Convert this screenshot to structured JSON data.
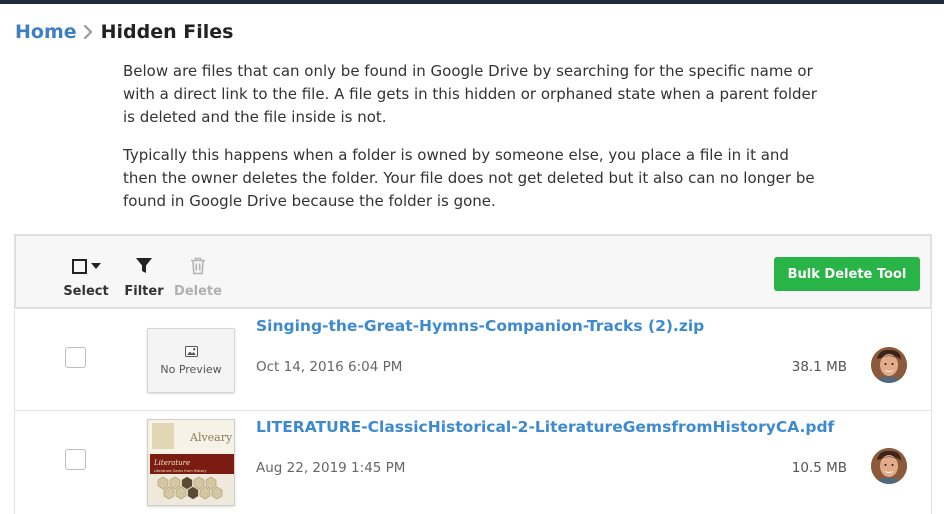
{
  "breadcrumb": {
    "home": "Home",
    "current": "Hidden Files"
  },
  "description": {
    "p1": "Below are files that can only be found in Google Drive by searching for the specific name or with a direct link to the file. A file gets in this hidden or orphaned state when a parent folder is deleted and the file inside is not.",
    "p2": "Typically this happens when a folder is owned by someone else, you place a file in it and then the owner deletes the folder. Your file does not get deleted but it also can no longer be found in Google Drive because the folder is gone."
  },
  "toolbar": {
    "select_label": "Select",
    "filter_label": "Filter",
    "delete_label": "Delete",
    "bulk_delete_label": "Bulk Delete Tool"
  },
  "files": [
    {
      "name": "Singing-the-Great-Hymns-Companion-Tracks (2).zip",
      "date": "Oct 14, 2016 6:04 PM",
      "size": "38.1 MB",
      "preview": "No Preview"
    },
    {
      "name": "LITERATURE-ClassicHistorical-2-LiteratureGemsfromHistoryCA.pdf",
      "date": "Aug 22, 2019 1:45 PM",
      "size": "10.5 MB",
      "thumb_brand": "Alveary",
      "thumb_title": "Literature",
      "thumb_subtitle": "Literature Gems from History"
    }
  ],
  "colors": {
    "link": "#3d8ad0",
    "bulk_button": "#28b446",
    "topbar": "#1f2d3a"
  }
}
